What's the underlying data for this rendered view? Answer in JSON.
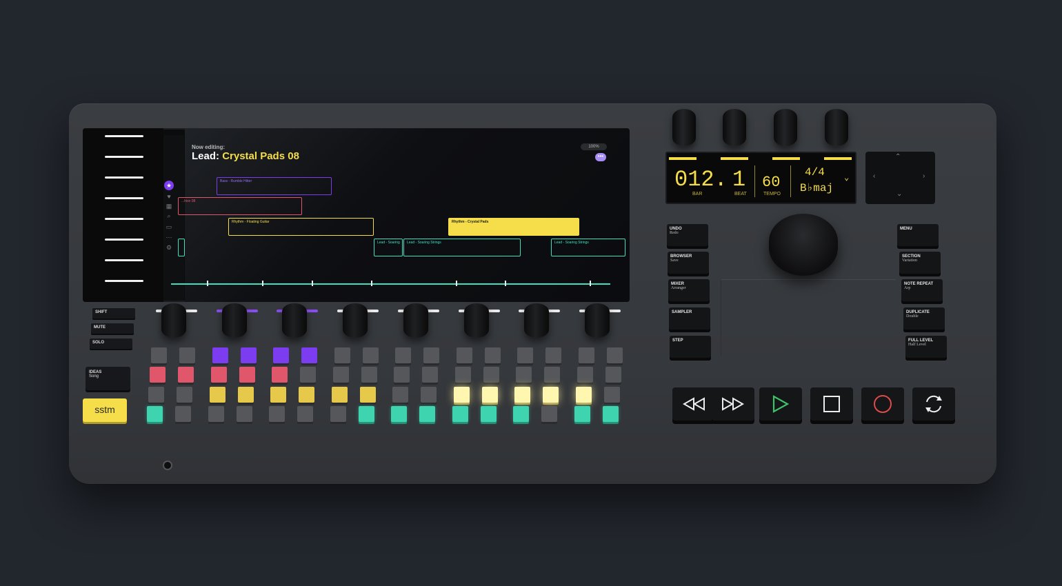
{
  "screen": {
    "now_editing_label": "Now editing:",
    "track_prefix": "Lead:",
    "track_name": "Crystal Pads 08",
    "zoom": "100%",
    "more_label": "•••",
    "clips": [
      {
        "label": "Bass - Rumble Hitter",
        "color": "#7c3cf0"
      },
      {
        "label": "...hive 08",
        "color": "#e0566a"
      },
      {
        "label": "Rhythm - Floating Guitar",
        "color": "#f5de4a"
      },
      {
        "label": "Rhythm - Crystal Pads",
        "color": "#f5de4a"
      },
      {
        "label": "Lead - Soaring",
        "color": "#3ee0c0"
      },
      {
        "label": "Lead - Soaring Strings",
        "color": "#3ee0c0"
      },
      {
        "label": "Lead - Soaring Strings",
        "color": "#3ee0c0"
      }
    ]
  },
  "left_buttons": {
    "shift": "SHIFT",
    "mute": "MUTE",
    "solo": "SOLO",
    "ideas_title": "IDEAS",
    "ideas_sub": "Song",
    "brand": "sstm"
  },
  "display": {
    "bar": "012.",
    "beat": "1",
    "bar_label": "BAR",
    "beat_label": "BEAT",
    "tempo": "60",
    "tempo_label": "TEMPO",
    "time_sig": "4/4",
    "key": "B♭maj"
  },
  "functions": {
    "undo": {
      "title": "UNDO",
      "sub": "Redo"
    },
    "browser": {
      "title": "BROWSER",
      "sub": "Save"
    },
    "mixer": {
      "title": "MIXER",
      "sub": "Arranger"
    },
    "sampler": {
      "title": "SAMPLER",
      "sub": ""
    },
    "step": {
      "title": "STEP",
      "sub": ""
    },
    "menu": {
      "title": "MENU",
      "sub": ""
    },
    "section": {
      "title": "SECTION",
      "sub": "Variation"
    },
    "note_repeat": {
      "title": "NOTE REPEAT",
      "sub": "Arp"
    },
    "duplicate": {
      "title": "DUPLICATE",
      "sub": "Double"
    },
    "full_level": {
      "title": "FULL LEVEL",
      "sub": "Half Level"
    }
  },
  "pads": {
    "colors": {
      "off": "#55575a",
      "red": "#e0566a",
      "purple": "#7c3cf0",
      "yellow": "#e6c94a",
      "cream": "#fff7b0",
      "teal": "#3ed4b0"
    },
    "rows": [
      [
        "off",
        "off",
        "purple",
        "purple",
        "purple",
        "purple",
        "off",
        "off",
        "off",
        "off",
        "off",
        "off",
        "off",
        "off",
        "off",
        "off"
      ],
      [
        "red",
        "red",
        "red",
        "red",
        "red",
        "off",
        "off",
        "off",
        "off",
        "off",
        "off",
        "off",
        "off",
        "off",
        "off",
        "off"
      ],
      [
        "off",
        "off",
        "yellow",
        "yellow",
        "yellow",
        "yellow",
        "yellow",
        "yellow",
        "off",
        "off",
        "cream",
        "cream",
        "cream",
        "cream",
        "cream",
        "off"
      ],
      [
        "teal",
        "off",
        "off",
        "off",
        "off",
        "off",
        "off",
        "teal",
        "teal",
        "teal",
        "teal",
        "teal",
        "teal",
        "off",
        "teal",
        "teal"
      ]
    ]
  },
  "transport": [
    "rewind-icon",
    "fast-forward-icon",
    "play-icon",
    "stop-icon",
    "record-icon",
    "loop-icon"
  ],
  "accent_colors": {
    "yellow": "#f5de4a",
    "green_play": "#3fc36a",
    "red_record": "#e04a4a"
  }
}
